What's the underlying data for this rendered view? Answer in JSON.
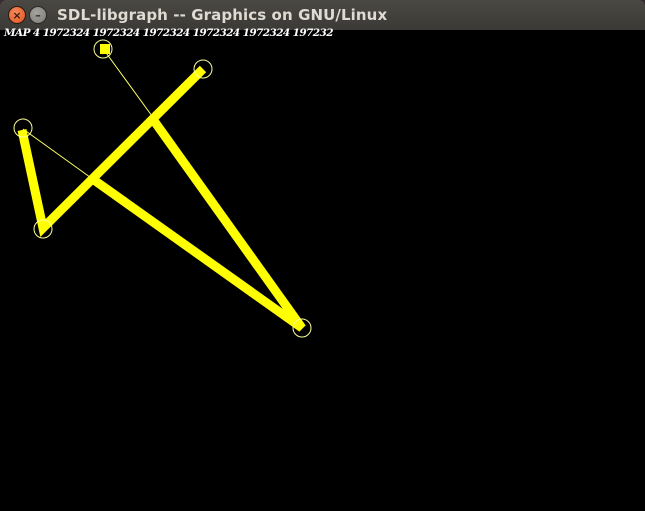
{
  "window": {
    "title": "SDL-libgraph -- Graphics on GNU/Linux",
    "close_glyph": "×",
    "minimize_glyph": "–"
  },
  "canvas": {
    "map_text": "MAP 4 1972324 1972324 1972324 1972324 1972324 197232",
    "background": "#000000",
    "line_color": "#ffff00",
    "circle_color": "#ffff99",
    "text_color": "#ffffff"
  }
}
